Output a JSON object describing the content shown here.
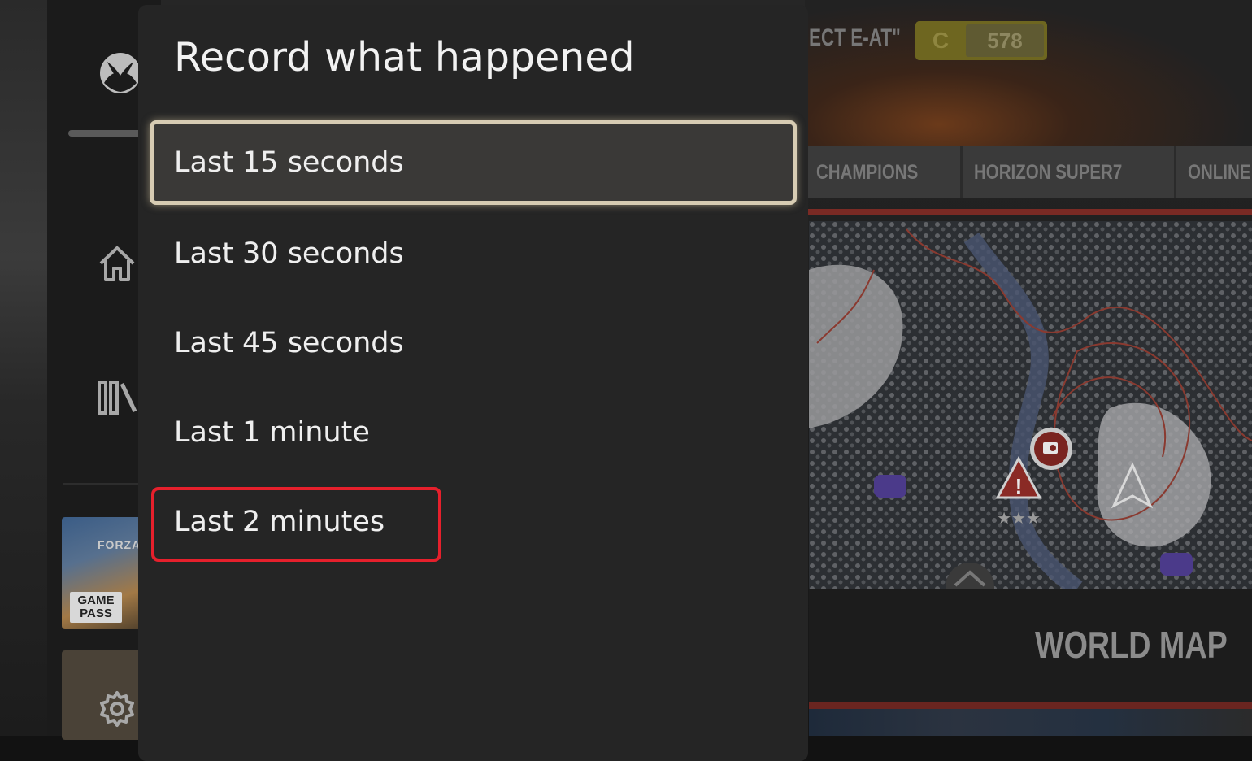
{
  "background_game": {
    "car_name_partial": "ECT E-AT\"",
    "performance_class": "C",
    "performance_index": "578",
    "tabs": [
      "CHAMPIONS",
      "HORIZON SUPER7",
      "ONLINE"
    ],
    "map_label": "WORLD MAP"
  },
  "guide": {
    "icons": [
      "xbox-logo",
      "home-icon",
      "library-icon",
      "settings-icon"
    ],
    "game_tile": {
      "logo_text": "FORZA",
      "badge_text": "GAME\nPASS"
    }
  },
  "menu": {
    "title": "Record what happened",
    "options": [
      {
        "label": "Last 15 seconds",
        "focused": true
      },
      {
        "label": "Last 30 seconds",
        "focused": false
      },
      {
        "label": "Last 45 seconds",
        "focused": false
      },
      {
        "label": "Last 1 minute",
        "focused": false
      },
      {
        "label": "Last 2 minutes",
        "focused": false
      }
    ],
    "focus_border_color": "#d7ccb3",
    "annotation_color": "#e6202c"
  }
}
